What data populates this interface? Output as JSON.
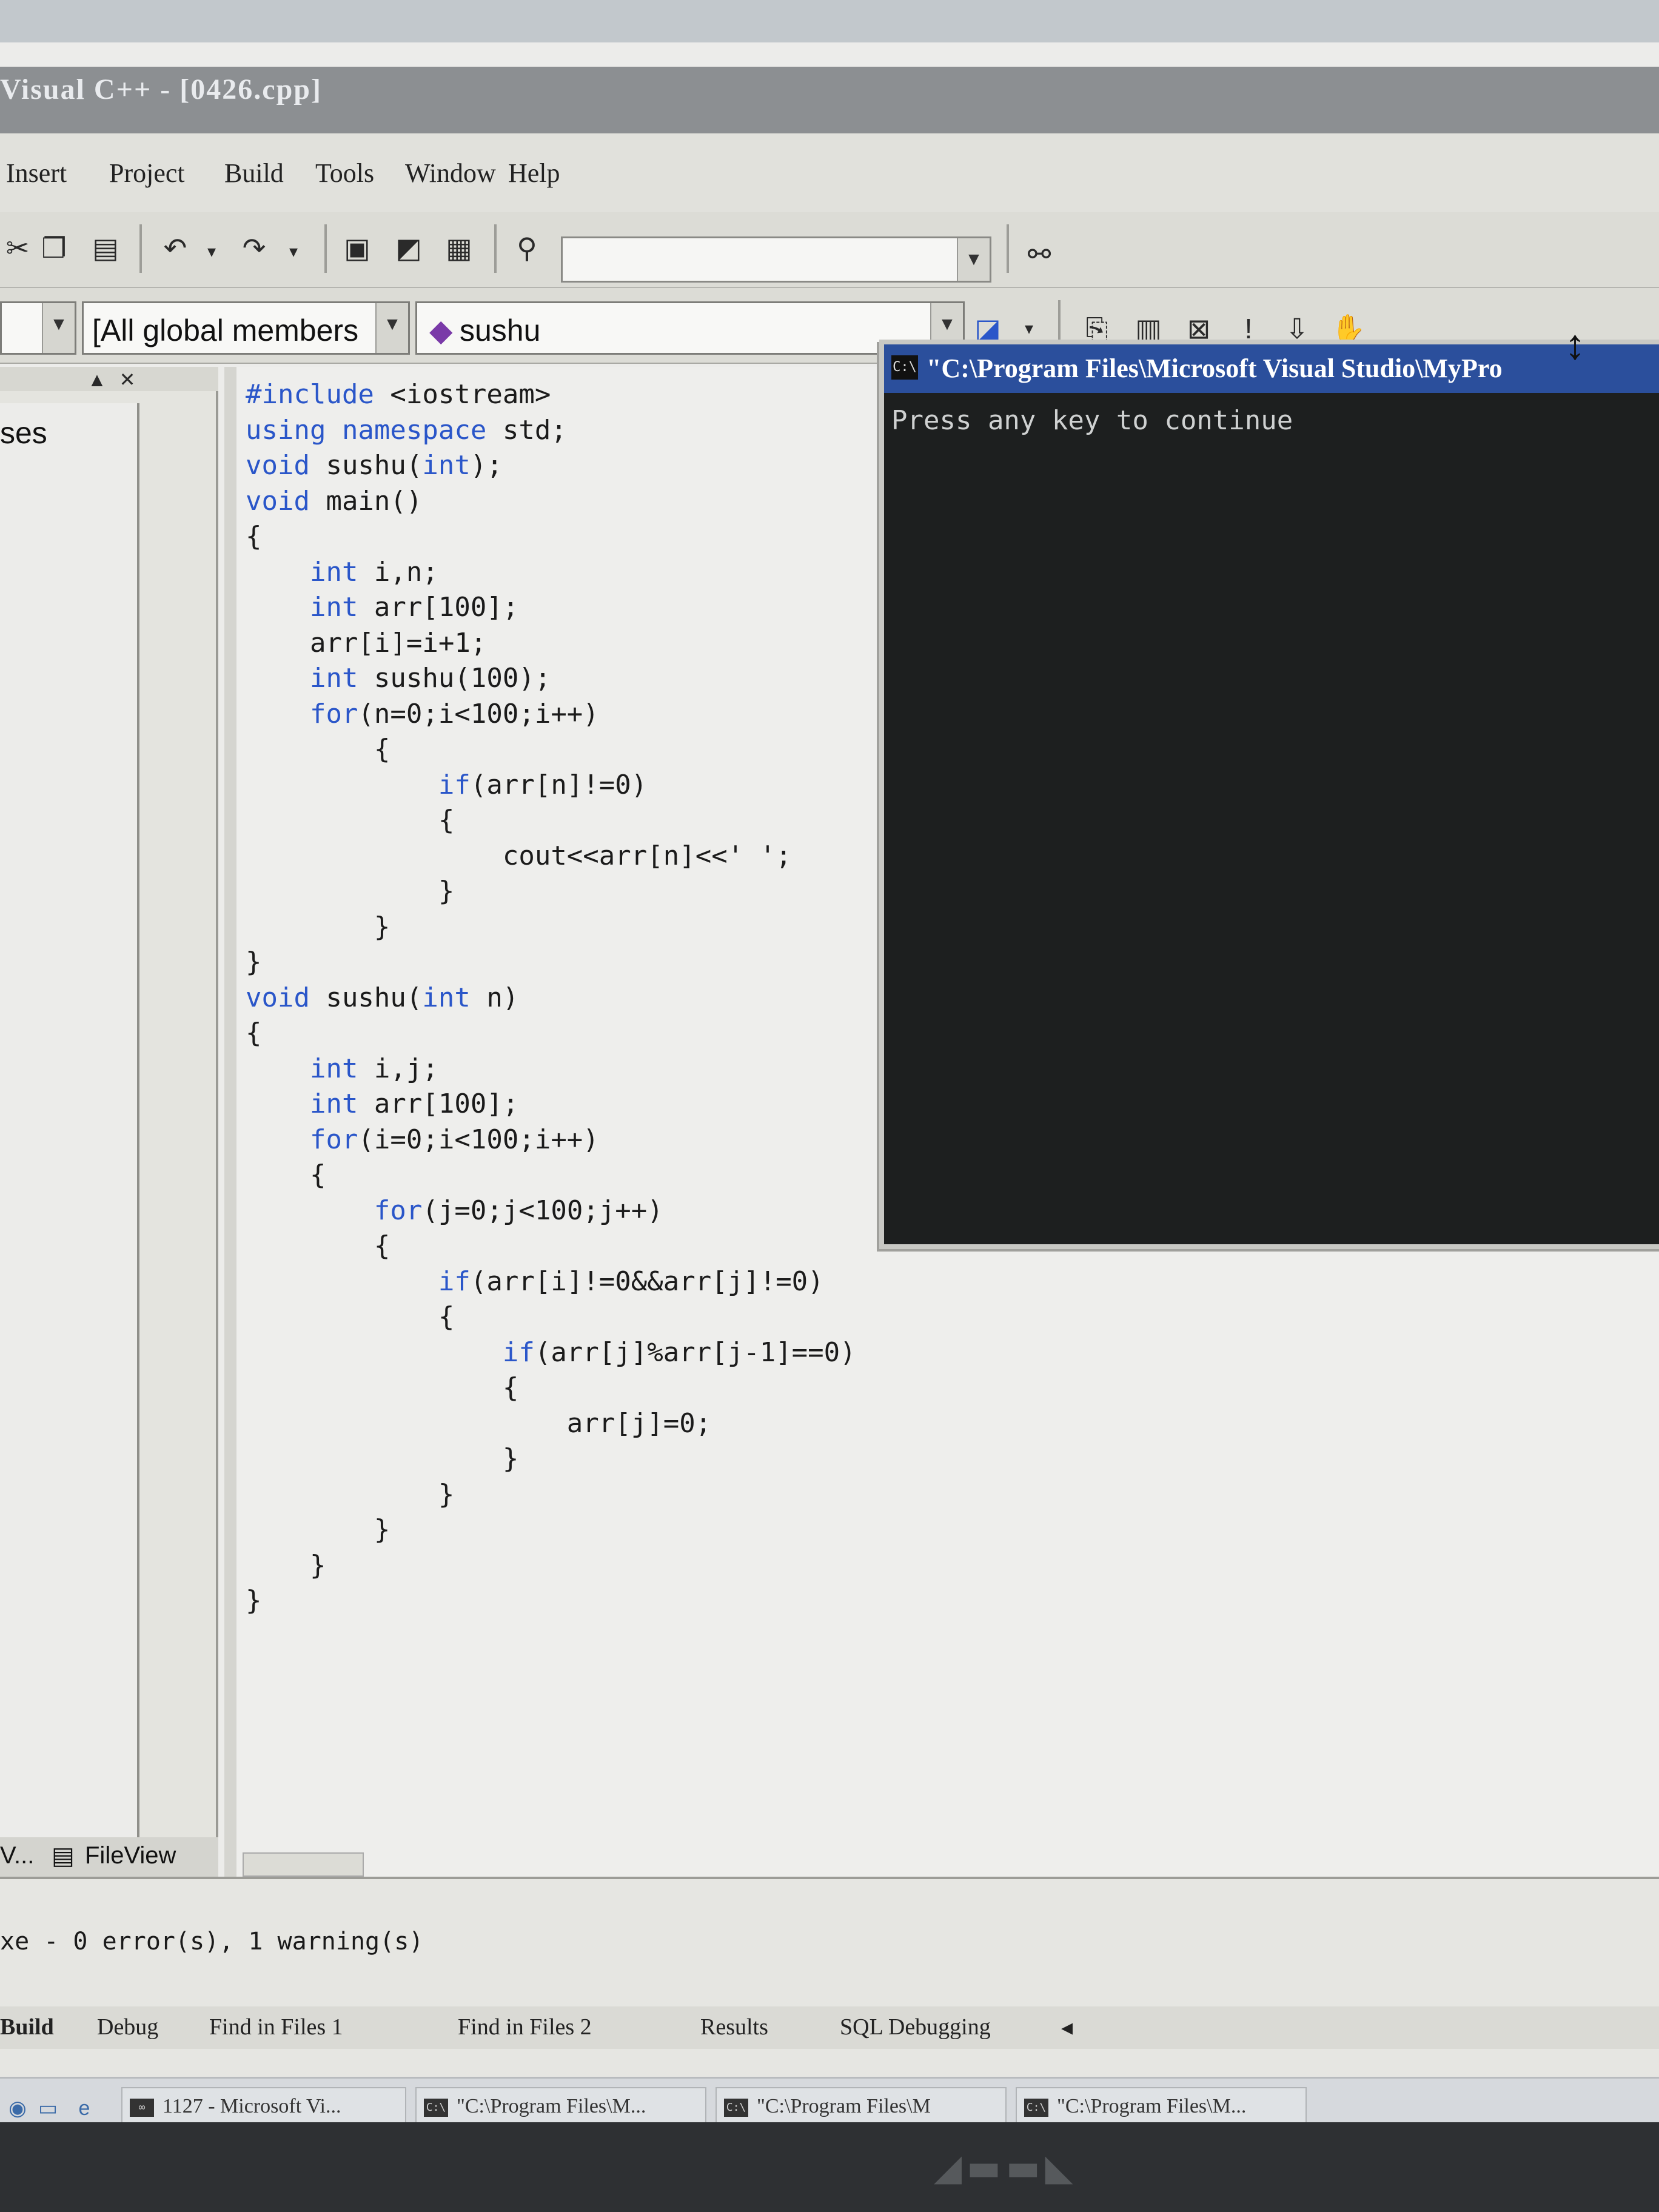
{
  "window": {
    "title": "Visual C++ - [0426.cpp]"
  },
  "menu": {
    "items": [
      "Insert",
      "Project",
      "Build",
      "Tools",
      "Window",
      "Help"
    ]
  },
  "toolbar": {
    "icons": [
      "cut-icon",
      "copy-icon",
      "paste-icon",
      "undo-icon",
      "redo-icon",
      "workspace-icon",
      "output-icon",
      "window-list-icon",
      "find-in-files-icon",
      "find-icon"
    ],
    "find_value": ""
  },
  "wizardbar": {
    "class_combo": "",
    "members_combo": "[All global members",
    "function_combo": "sushu",
    "build_icons": [
      "compile-icon",
      "build-icon",
      "stop-build-icon",
      "execute-icon",
      "go-icon",
      "insert-breakpoint-icon"
    ]
  },
  "workspace": {
    "tree_text": "ses",
    "tabs": [
      "V...",
      "FileView"
    ]
  },
  "editor": {
    "lines": [
      [
        {
          "t": "#include ",
          "k": true
        },
        {
          "t": "<iostream>",
          "k": false
        }
      ],
      [
        {
          "t": "using namespace ",
          "k": true
        },
        {
          "t": "std;",
          "k": false
        }
      ],
      [
        {
          "t": "void ",
          "k": true
        },
        {
          "t": "sushu(",
          "k": false
        },
        {
          "t": "int",
          "k": true
        },
        {
          "t": ");",
          "k": false
        }
      ],
      [
        {
          "t": "void ",
          "k": true
        },
        {
          "t": "main()",
          "k": false
        }
      ],
      [
        {
          "t": "{",
          "k": false
        }
      ],
      [
        {
          "t": "    int ",
          "k": true
        },
        {
          "t": "i,n;",
          "k": false
        }
      ],
      [
        {
          "t": "    int ",
          "k": true
        },
        {
          "t": "arr[100];",
          "k": false
        }
      ],
      [
        {
          "t": "    arr[i]=i+1;",
          "k": false
        }
      ],
      [
        {
          "t": "    int ",
          "k": true
        },
        {
          "t": "sushu(100);",
          "k": false
        }
      ],
      [
        {
          "t": "    for",
          "k": true
        },
        {
          "t": "(n=0;i<100;i++)",
          "k": false
        }
      ],
      [
        {
          "t": "        {",
          "k": false
        }
      ],
      [
        {
          "t": "            if",
          "k": true
        },
        {
          "t": "(arr[n]!=0)",
          "k": false
        }
      ],
      [
        {
          "t": "            {",
          "k": false
        }
      ],
      [
        {
          "t": "                cout<<arr[n]<<' ';",
          "k": false
        }
      ],
      [
        {
          "t": "            }",
          "k": false
        }
      ],
      [
        {
          "t": "        }",
          "k": false
        }
      ],
      [
        {
          "t": "}",
          "k": false
        }
      ],
      [
        {
          "t": "void ",
          "k": true
        },
        {
          "t": "sushu(",
          "k": false
        },
        {
          "t": "int",
          "k": true
        },
        {
          "t": " n)",
          "k": false
        }
      ],
      [
        {
          "t": "{",
          "k": false
        }
      ],
      [
        {
          "t": "    int ",
          "k": true
        },
        {
          "t": "i,j;",
          "k": false
        }
      ],
      [
        {
          "t": "    int ",
          "k": true
        },
        {
          "t": "arr[100];",
          "k": false
        }
      ],
      [
        {
          "t": "    for",
          "k": true
        },
        {
          "t": "(i=0;i<100;i++)",
          "k": false
        }
      ],
      [
        {
          "t": "    {",
          "k": false
        }
      ],
      [
        {
          "t": "        for",
          "k": true
        },
        {
          "t": "(j=0;j<100;j++)",
          "k": false
        }
      ],
      [
        {
          "t": "        {",
          "k": false
        }
      ],
      [
        {
          "t": "            if",
          "k": true
        },
        {
          "t": "(arr[i]!=0&&arr[j]!=0)",
          "k": false
        }
      ],
      [
        {
          "t": "            {",
          "k": false
        }
      ],
      [
        {
          "t": "                if",
          "k": true
        },
        {
          "t": "(arr[j]%arr[j-1]==0)",
          "k": false
        }
      ],
      [
        {
          "t": "                {",
          "k": false
        }
      ],
      [
        {
          "t": "                    arr[j]=0;",
          "k": false
        }
      ],
      [
        {
          "t": "                }",
          "k": false
        }
      ],
      [
        {
          "t": "            }",
          "k": false
        }
      ],
      [
        {
          "t": "        }",
          "k": false
        }
      ],
      [
        {
          "t": "    }",
          "k": false
        }
      ],
      [
        {
          "t": "}",
          "k": false
        }
      ]
    ]
  },
  "console": {
    "icon_text": "C:\\",
    "title": "\"C:\\Program Files\\Microsoft Visual Studio\\MyPro",
    "output": "Press any key to continue"
  },
  "output": {
    "message": "xe - 0 error(s), 1 warning(s)",
    "tabs": [
      "Build",
      "Debug",
      "Find in Files 1",
      "Find in Files 2",
      "Results",
      "SQL Debugging"
    ]
  },
  "taskbar": {
    "buttons": [
      {
        "icon": "∞",
        "label": "1127 - Microsoft Vi..."
      },
      {
        "icon": "C:\\",
        "label": "\"C:\\Program Files\\M..."
      },
      {
        "icon": "C:\\",
        "label": "\"C:\\Program Files\\M"
      },
      {
        "icon": "C:\\",
        "label": "\"C:\\Program Files\\M..."
      }
    ]
  },
  "colors": {
    "keyword": "#2a56c9",
    "console_title": "#2b4f9c",
    "console_bg": "#1d1f1f"
  }
}
